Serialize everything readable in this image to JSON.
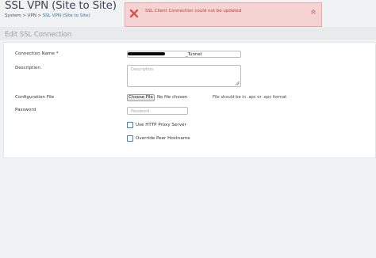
{
  "page": {
    "title": "SSL VPN (Site to Site)",
    "breadcrumb": [
      "System",
      "VPN",
      "SSL VPN (Site to Site)"
    ],
    "breadcrumb_separator": ">"
  },
  "alert": {
    "message": "SSL Client Connection could not be updated",
    "icon": "close-x-icon",
    "collapse_icon": "chevron-up-double-icon",
    "color": "#d9534f"
  },
  "section": {
    "title": "Edit SSL Connection"
  },
  "form": {
    "connection_name": {
      "label": "Connection Name *",
      "value": "_Tunnel"
    },
    "description": {
      "label": "Description",
      "placeholder": "Description"
    },
    "config_file": {
      "label": "Configuration File",
      "button": "Choose File",
      "status": "No file chosen",
      "hint": "File should be in .apc or .epc format"
    },
    "password": {
      "label": "Password",
      "placeholder": "Password"
    },
    "http_proxy": {
      "label": "Use HTTP Proxy Server",
      "checked": false
    },
    "override_peer": {
      "label": "Override Peer Hostname",
      "checked": false
    }
  }
}
